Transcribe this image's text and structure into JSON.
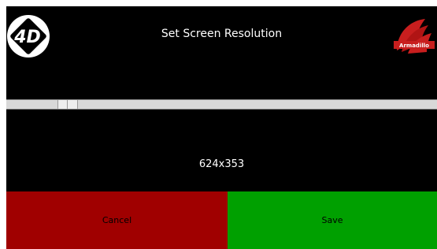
{
  "title": "Set Screen Resolution",
  "brand_text": "Armadillo",
  "resolution": {
    "value_label": "624x353",
    "slider_fraction": 0.124
  },
  "buttons": {
    "cancel_label": "Cancel",
    "save_label": "Save"
  },
  "colors": {
    "screen_bg": "#000000",
    "cancel": "#a00000",
    "save": "#00a000",
    "brand": "#c81e1e"
  },
  "icons": {
    "left_logo": "4d-logo-icon",
    "right_logo": "armadillo-logo-icon"
  }
}
